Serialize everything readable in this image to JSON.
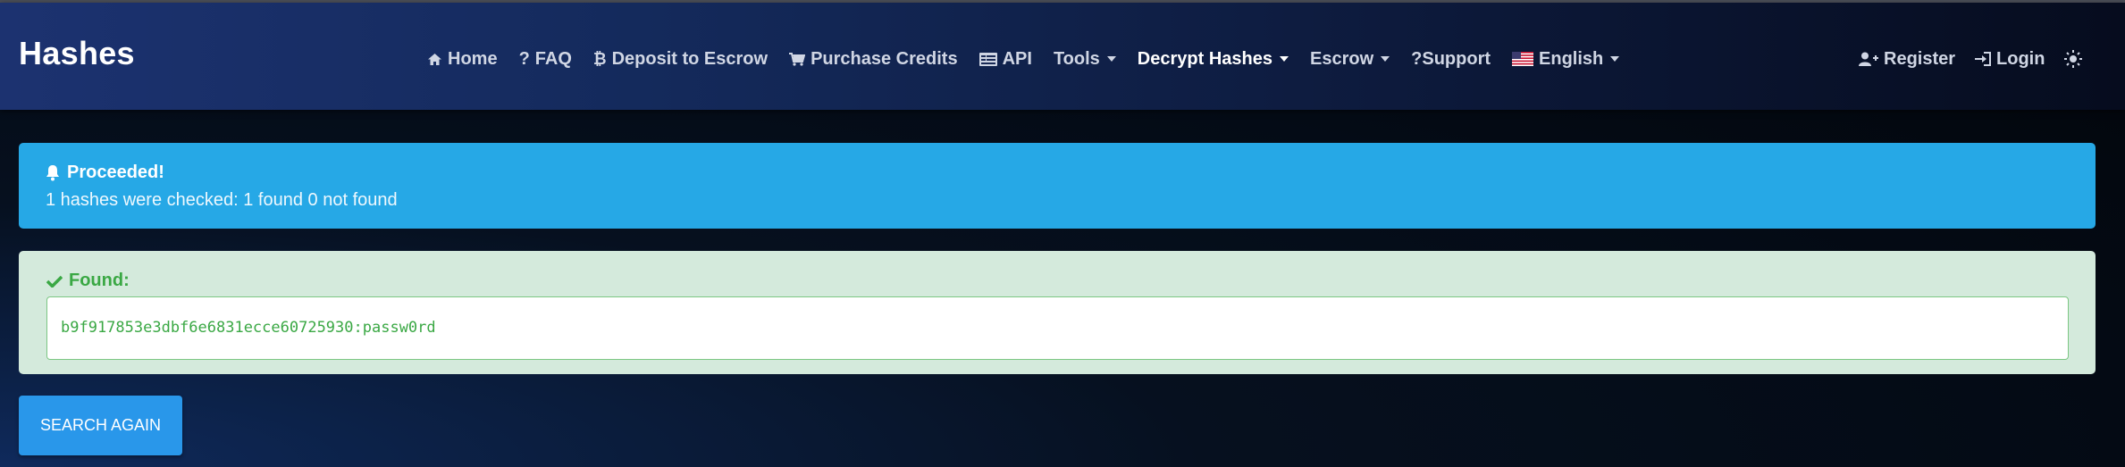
{
  "brand": "Hashes",
  "nav": {
    "items": [
      {
        "label": "Home",
        "icon": "home-icon"
      },
      {
        "label": "FAQ",
        "icon": "question-icon"
      },
      {
        "label": "Deposit to Escrow",
        "icon": "bitcoin-icon"
      },
      {
        "label": "Purchase Credits",
        "icon": "cart-icon"
      },
      {
        "label": "API",
        "icon": "api-icon"
      },
      {
        "label": "Tools",
        "dropdown": true
      },
      {
        "label": "Decrypt Hashes",
        "dropdown": true,
        "active": true
      },
      {
        "label": "Escrow",
        "dropdown": true
      },
      {
        "label": "?Support"
      },
      {
        "label": "English",
        "icon": "us-flag-icon",
        "dropdown": true
      }
    ],
    "right": [
      {
        "label": "Register",
        "icon": "user-plus-icon"
      },
      {
        "label": "Login",
        "icon": "sign-in-icon"
      }
    ],
    "theme_icon": "sun-icon"
  },
  "alert": {
    "title": "Proceeded!",
    "message": "1 hashes were checked: 1 found 0 not found",
    "icon": "bell-icon",
    "color": "#26a8e6"
  },
  "found": {
    "title": "Found:",
    "icon": "check-icon",
    "result": "b9f917853e3dbf6e6831ecce60725930:passw0rd",
    "color": "#3aa844"
  },
  "search_again_label": "SEARCH AGAIN"
}
